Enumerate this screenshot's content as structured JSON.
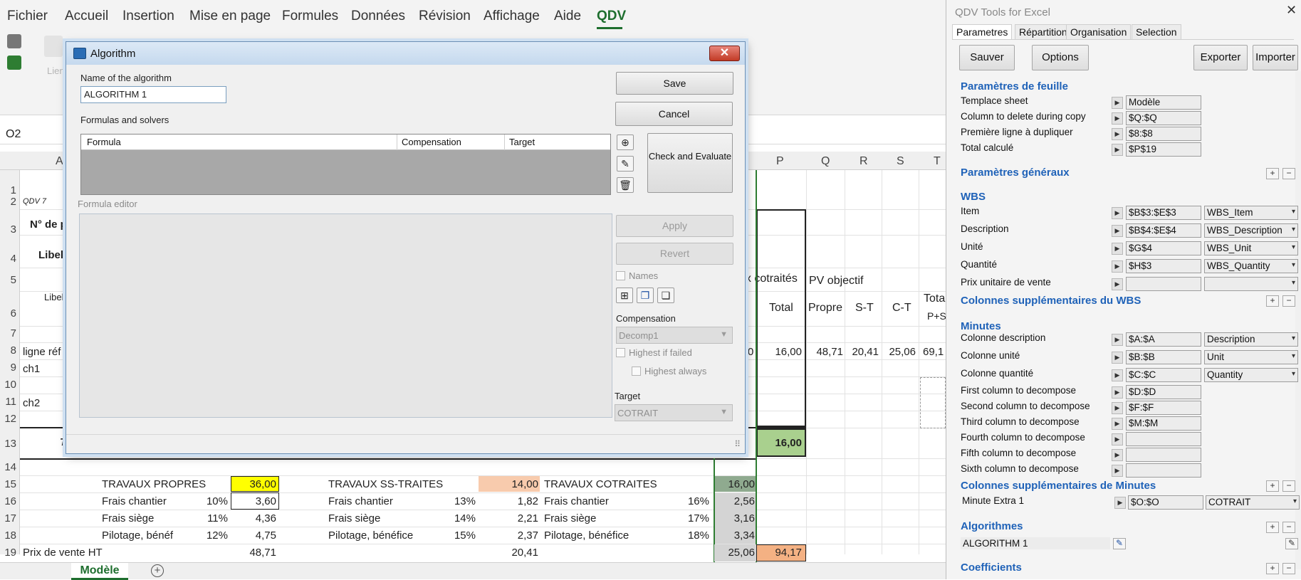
{
  "ribbon": {
    "menu": [
      "Fichier",
      "Accueil",
      "Insertion",
      "Mise en page",
      "Formules",
      "Données",
      "Révision",
      "Affichage",
      "Aide",
      "QDV"
    ],
    "active": "QDV",
    "faded_left": "Lien"
  },
  "namebox": "O2",
  "sheet": {
    "columns": {
      "A": "A",
      "P": "P",
      "Q": "Q",
      "R": "R",
      "S": "S",
      "T": "T"
    },
    "rows": [
      "1",
      "2",
      "3",
      "4",
      "5",
      "6",
      "7",
      "8",
      "9",
      "10",
      "11",
      "12",
      "13",
      "14",
      "15",
      "16",
      "17",
      "18",
      "19"
    ],
    "a2": "QDV 7",
    "a3": "N° de p",
    "a4": "Libell",
    "a5": "Libel",
    "a8": "ligne réf",
    "a9": "ch1",
    "a11": "ch2",
    "a13": "T",
    "hdr_cotraites": "ux cotraités",
    "hdr_pv_objectif": "PV objectif",
    "hdr_total": "Total",
    "hdr_propre": "Propre",
    "hdr_st": "S-T",
    "hdr_ct": "C-T",
    "hdr_tota": "Tota",
    "hdr_ps": "P+S",
    "r8_o": "0",
    "r8_p": "16,00",
    "r8_q": "48,71",
    "r8_r": "20,41",
    "r8_s": "25,06",
    "r8_t": "69,1",
    "r13_p": "16,00",
    "summary": [
      {
        "label": "TRAVAUX PROPRES",
        "pct": "",
        "val": "36,00",
        "label2": "TRAVAUX SS-TRAITES",
        "pct2": "",
        "val2": "14,00",
        "label3": "TRAVAUX COTRAITES",
        "pct3": "",
        "val3": "16,00"
      },
      {
        "label": "Frais chantier",
        "pct": "10%",
        "val": "3,60",
        "label2": "Frais chantier",
        "pct2": "13%",
        "val2": "1,82",
        "label3": "Frais chantier",
        "pct3": "16%",
        "val3": "2,56"
      },
      {
        "label": "Frais siège",
        "pct": "11%",
        "val": "4,36",
        "label2": "Frais siège",
        "pct2": "14%",
        "val2": "2,21",
        "label3": "Frais siège",
        "pct3": "17%",
        "val3": "3,16"
      },
      {
        "label": "Pilotage, bénéf",
        "pct": "12%",
        "val": "4,75",
        "label2": "Pilotage, bénéfice",
        "pct2": "15%",
        "val2": "2,37",
        "label3": "Pilotage, bénéfice",
        "pct3": "18%",
        "val3": "3,34"
      }
    ],
    "r19_label": "Prix de vente HT",
    "r19_a": "48,71",
    "r19_b": "20,41",
    "r19_c": "25,06",
    "r19_d": "94,17",
    "tab": "Modèle"
  },
  "dialog": {
    "title": "Algorithm",
    "close": "✕",
    "name_label": "Name of the algorithm",
    "name_value": "ALGORITHM 1",
    "formulas_label": "Formulas and solvers",
    "col_formula": "Formula",
    "col_compensation": "Compensation",
    "col_target": "Target",
    "editor_label": "Formula editor",
    "save": "Save",
    "cancel": "Cancel",
    "check_evaluate": "Check and Evaluate",
    "apply": "Apply",
    "revert": "Revert",
    "names": "Names",
    "compensation_label": "Compensation",
    "compensation_value": "Decomp1",
    "highest_if_failed": "Highest if failed",
    "highest_always": "Highest always",
    "target_label": "Target",
    "target_value": "COTRAIT"
  },
  "pane": {
    "title": "QDV Tools for Excel",
    "close": "✕",
    "tabs": [
      "Parametres",
      "Répartition",
      "Organisation",
      "Selection"
    ],
    "buttons": {
      "save": "Sauver",
      "options": "Options",
      "export": "Exporter",
      "import": "Importer"
    },
    "sheet_params": {
      "title": "Paramètres de feuille",
      "rows": [
        {
          "label": "Templace sheet",
          "value": "Modèle"
        },
        {
          "label": "Column to delete during copy",
          "value": "$Q:$Q"
        },
        {
          "label": "Première ligne à dupliquer",
          "value": "$8:$8"
        },
        {
          "label": "Total calculé",
          "value": "$P$19"
        }
      ]
    },
    "general_params": "Paramètres généraux",
    "wbs": {
      "title": "WBS",
      "rows": [
        {
          "label": "Item",
          "value": "$B$3:$E$3",
          "combo": "WBS_Item"
        },
        {
          "label": "Description",
          "value": "$B$4:$E$4",
          "combo": "WBS_Description"
        },
        {
          "label": "Unité",
          "value": "$G$4",
          "combo": "WBS_Unit"
        },
        {
          "label": "Quantité",
          "value": "$H$3",
          "combo": "WBS_Quantity"
        },
        {
          "label": "Prix unitaire de vente",
          "value": "",
          "combo": ""
        }
      ]
    },
    "wbs_extra": "Colonnes supplémentaires du WBS",
    "minutes": {
      "title": "Minutes",
      "rows": [
        {
          "label": "Colonne description",
          "value": "$A:$A",
          "combo": "Description"
        },
        {
          "label": "Colonne unité",
          "value": "$B:$B",
          "combo": "Unit"
        },
        {
          "label": "Colonne quantité",
          "value": "$C:$C",
          "combo": "Quantity"
        },
        {
          "label": "First column to decompose",
          "value": "$D:$D"
        },
        {
          "label": "Second column to decompose",
          "value": "$F:$F"
        },
        {
          "label": "Third column to decompose",
          "value": "$M:$M"
        },
        {
          "label": "Fourth column to decompose",
          "value": ""
        },
        {
          "label": "Fifth column to decompose",
          "value": ""
        },
        {
          "label": "Sixth column to decompose",
          "value": ""
        }
      ]
    },
    "minutes_extra": {
      "title": "Colonnes supplémentaires de Minutes",
      "label": "Minute Extra 1",
      "value": "$O:$O",
      "combo": "COTRAIT"
    },
    "algorithms": {
      "title": "Algorithmes",
      "item": "ALGORITHM 1"
    },
    "coefficients": "Coefficients"
  },
  "colors": {
    "yellow": "#ffff00",
    "salmon": "#f8cbad",
    "green": "#a9d08e",
    "dark_green_gray": "#8faa8f",
    "orange": "#f4b183",
    "accent": "#1e6e2e",
    "pane_blue": "#1f62b8"
  }
}
